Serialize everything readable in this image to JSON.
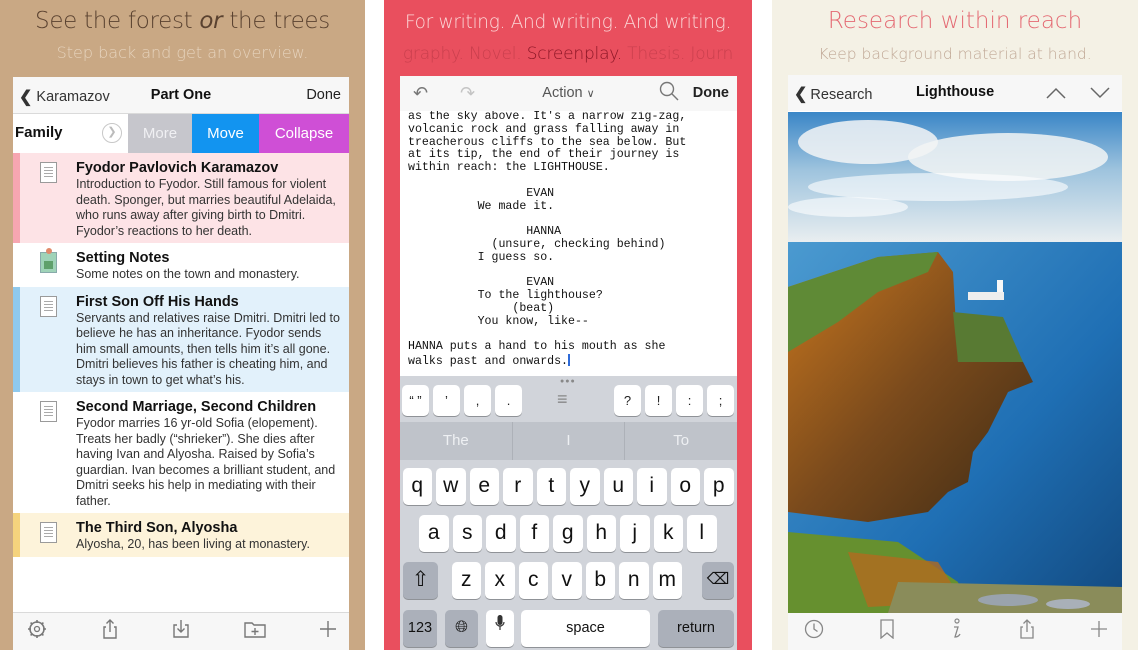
{
  "panels": {
    "overview": {
      "headline": "See the forest ",
      "headline_em": "or",
      "headline_tail": " the trees",
      "subhead": "Step back and get an overview.",
      "colors": {
        "background": "#c9a884",
        "move": "#1294f0",
        "collapse": "#cf4fd6",
        "more": "#c6c6cc"
      },
      "navbar": {
        "back_label": "Karamazov",
        "title": "Part One",
        "done_label": "Done"
      },
      "swipe_row": {
        "label": "Family",
        "more": "More",
        "move": "Move",
        "collapse": "Collapse"
      },
      "items": [
        {
          "title": "Fyodor Pavlovich  Karamazov",
          "text": "Introduction to Fyodor. Still famous for violent death. Sponger, but marries beautiful Adelaida, who runs away after giving birth to Dmitri. Fyodor’s reactions to her death.",
          "label_color": "pink",
          "icon": "document-icon"
        },
        {
          "title": "Setting Notes",
          "text": "Some notes on the town and monastery.",
          "label_color": "none",
          "icon": "image-document-icon"
        },
        {
          "title": "First Son Off His Hands",
          "text": "Servants and relatives raise Dmitri. Dmitri led to believe he has an inheritance. Fyodor sends him small amounts, then tells him it’s all gone. Dmitri believes his father is cheating him, and stays in town to get what’s his.",
          "label_color": "blue",
          "icon": "document-icon"
        },
        {
          "title": "Second Marriage, Second Children",
          "text": "Fyodor marries 16 yr-old Sofia (elopement). Treats her badly (“shrieker”). She dies after having Ivan and Alyosha. Raised by Sofia’s guardian. Ivan becomes a brilliant student, and Dmitri seeks his help in mediating with their father.",
          "label_color": "none",
          "icon": "document-icon"
        },
        {
          "title": "The Third Son, Alyosha",
          "text": "Alyosha, 20, has been living at monastery.",
          "label_color": "yellow",
          "icon": "document-icon"
        }
      ],
      "toolbar": [
        "settings-icon",
        "share-icon",
        "import-icon",
        "new-folder-icon",
        "add-icon"
      ]
    },
    "writing": {
      "headline": "For writing. And writing. And writing.",
      "subhead_pre": "graphy. Novel. ",
      "subhead_highlight": "Screenplay.",
      "subhead_post": " Thesis. Journ",
      "colors": {
        "background": "#e94f5e",
        "cursor": "#2e6bd8"
      },
      "editor_bar": {
        "format_label": "Action",
        "done_label": "Done"
      },
      "script_lines": [
        "as the sky above. It's a narrow zig-zag,",
        "volcanic rock and grass falling away in",
        "treacherous cliffs to the sea below. But",
        "at its tip, the end of their journey is",
        "within reach: the LIGHTHOUSE.",
        "",
        "                 EVAN",
        "          We made it.",
        "",
        "                 HANNA",
        "            (unsure, checking behind)",
        "          I guess so.",
        "",
        "                 EVAN",
        "          To the lighthouse?",
        "               (beat)",
        "          You know, like--",
        "",
        "HANNA puts a hand to his mouth as she",
        "walks past and onwards."
      ],
      "punctuation_left": [
        "“ ”",
        "’",
        ",",
        "."
      ],
      "punctuation_right": [
        "?",
        "!",
        ":",
        ";"
      ],
      "suggestions": [
        "The",
        "I",
        "To"
      ],
      "keyboard": {
        "row1": [
          "q",
          "w",
          "e",
          "r",
          "t",
          "y",
          "u",
          "i",
          "o",
          "p"
        ],
        "row2": [
          "a",
          "s",
          "d",
          "f",
          "g",
          "h",
          "j",
          "k",
          "l"
        ],
        "row3": [
          "z",
          "x",
          "c",
          "v",
          "b",
          "n",
          "m"
        ],
        "numbers_label": "123",
        "space_label": "space",
        "return_label": "return"
      }
    },
    "research": {
      "headline": "Research within reach",
      "subhead": "Keep background material at hand.",
      "colors": {
        "background": "#f4f1e5",
        "headline": "#e46a73"
      },
      "navbar": {
        "back_label": "Research",
        "title": "Lighthouse"
      },
      "image_alt": "Photo of a lighthouse on a green and orange sea cliff under a cloudy blue sky",
      "toolbar": [
        "history-icon",
        "bookmark-icon",
        "info-icon",
        "share-icon",
        "add-icon"
      ]
    }
  }
}
